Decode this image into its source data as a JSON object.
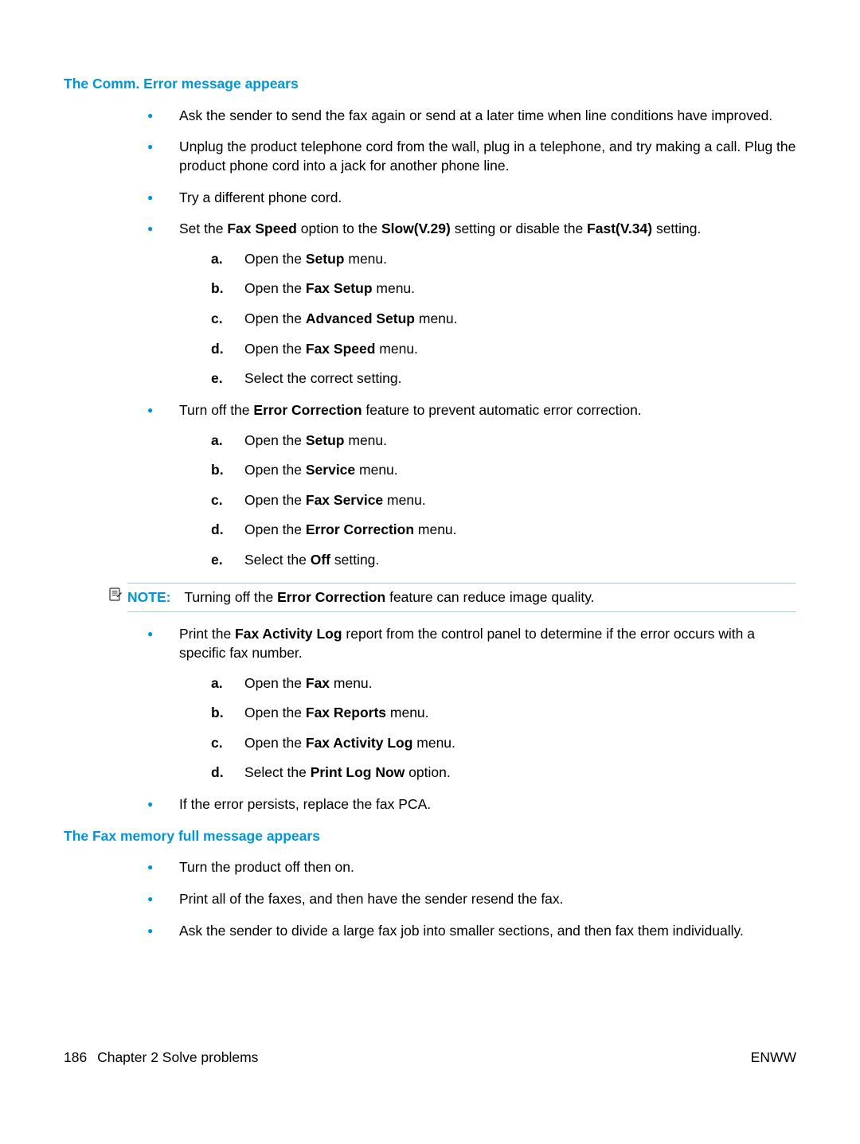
{
  "sections": {
    "comm_error": {
      "heading": "The Comm. Error message appears",
      "b1": "Ask the sender to send the fax again or send at a later time when line conditions have improved.",
      "b2": "Unplug the product telephone cord from the wall, plug in a telephone, and try making a call. Plug the product phone cord into a jack for another phone line.",
      "b3": "Try a different phone cord.",
      "b4_pre": "Set the ",
      "b4_bold1": "Fax Speed",
      "b4_mid1": " option to the ",
      "b4_bold2": "Slow(V.29)",
      "b4_mid2": " setting or disable the ",
      "b4_bold3": "Fast(V.34)",
      "b4_post": " setting.",
      "steps_speed": {
        "a_pre": "Open the ",
        "a_bold": "Setup",
        "a_post": " menu.",
        "b_pre": "Open the ",
        "b_bold": "Fax Setup",
        "b_post": " menu.",
        "c_pre": "Open the ",
        "c_bold": "Advanced Setup",
        "c_post": " menu.",
        "d_pre": "Open the ",
        "d_bold": "Fax Speed",
        "d_post": " menu.",
        "e": "Select the correct setting."
      },
      "b5_pre": "Turn off the ",
      "b5_bold": "Error Correction",
      "b5_post": " feature to prevent automatic error correction.",
      "steps_ec": {
        "a_pre": "Open the ",
        "a_bold": "Setup",
        "a_post": " menu.",
        "b_pre": "Open the ",
        "b_bold": "Service",
        "b_post": " menu.",
        "c_pre": "Open the ",
        "c_bold": "Fax Service",
        "c_post": " menu.",
        "d_pre": "Open the ",
        "d_bold": "Error Correction",
        "d_post": " menu.",
        "e_pre": "Select the ",
        "e_bold": "Off",
        "e_post": " setting."
      },
      "note_label": "NOTE:",
      "note_pre": "Turning off the ",
      "note_bold": "Error Correction",
      "note_post": " feature can reduce image quality.",
      "b6_pre": "Print the ",
      "b6_bold": "Fax Activity Log",
      "b6_post": " report from the control panel to determine if the error occurs with a specific fax number.",
      "steps_log": {
        "a_pre": "Open the ",
        "a_bold": "Fax",
        "a_post": " menu.",
        "b_pre": "Open the ",
        "b_bold": "Fax Reports",
        "b_post": " menu.",
        "c_pre": "Open the ",
        "c_bold": "Fax Activity Log",
        "c_post": " menu.",
        "d_pre": "Select the ",
        "d_bold": "Print Log Now",
        "d_post": " option."
      },
      "b7": "If the error persists, replace the fax PCA."
    },
    "mem_full": {
      "heading": "The Fax memory full message appears",
      "b1": "Turn the product off then on.",
      "b2": "Print all of the faxes, and then have the sender resend the fax.",
      "b3": "Ask the sender to divide a large fax job into smaller sections, and then fax them individually."
    }
  },
  "labels": {
    "a": "a.",
    "b": "b.",
    "c": "c.",
    "d": "d.",
    "e": "e."
  },
  "footer": {
    "page": "186",
    "chapter": "Chapter 2   Solve problems",
    "right": "ENWW"
  }
}
